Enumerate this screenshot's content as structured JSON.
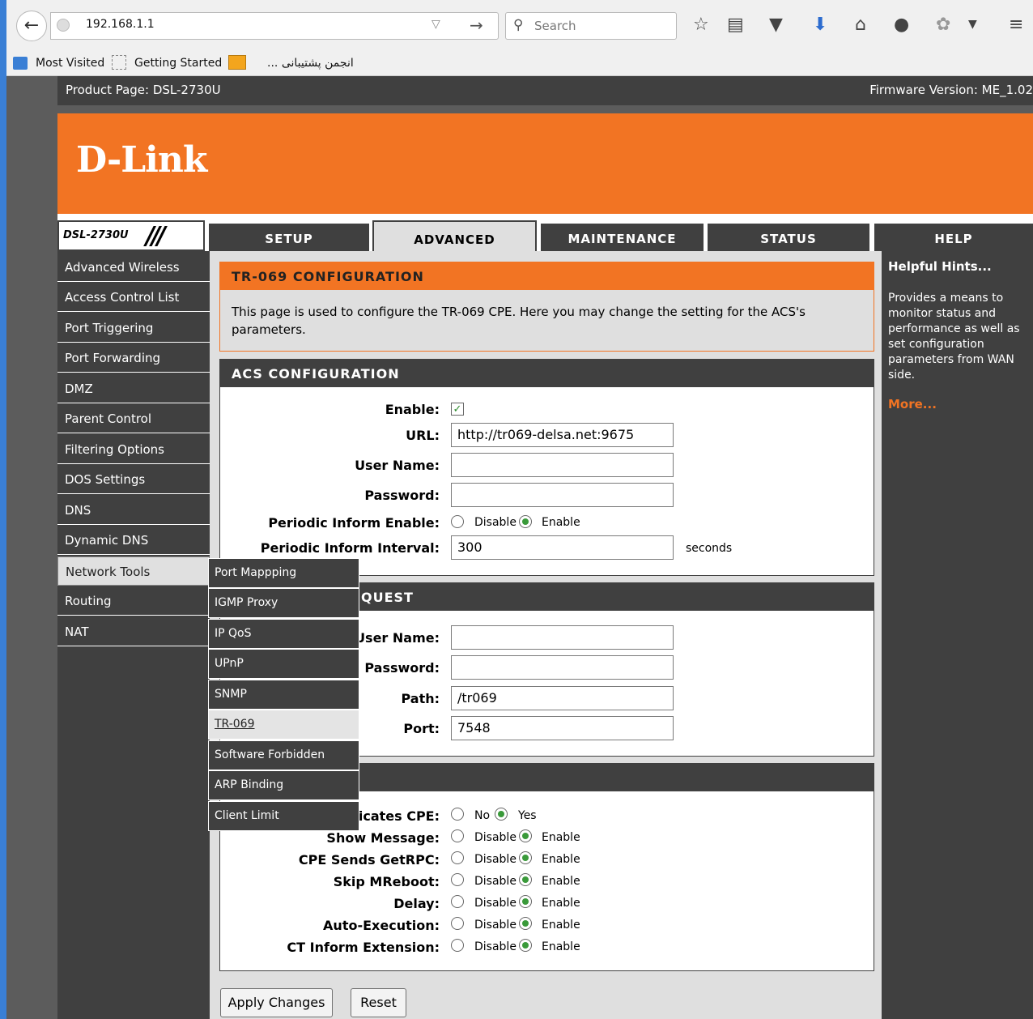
{
  "browser": {
    "url": "192.168.1.1",
    "search_placeholder": "Search",
    "bookmarks": [
      "Most Visited",
      "Getting Started",
      "... انجمن پشتیبانی"
    ]
  },
  "header": {
    "product": "Product Page: DSL-2730U",
    "firmware": "Firmware Version: ME_1.02",
    "logo": "D-Link",
    "model": "DSL-2730U"
  },
  "tabs": [
    "SETUP",
    "ADVANCED",
    "MAINTENANCE",
    "STATUS",
    "HELP"
  ],
  "sidebar": [
    "Advanced Wireless",
    "Access Control List",
    "Port Triggering",
    "Port Forwarding",
    "DMZ",
    "Parent Control",
    "Filtering Options",
    "DOS Settings",
    "DNS",
    "Dynamic DNS",
    "Network Tools",
    "Routing",
    "NAT"
  ],
  "submenu": [
    "Port Mappping",
    "IGMP Proxy",
    "IP QoS",
    "UPnP",
    "SNMP",
    "TR-069",
    "Software Forbidden",
    "ARP Binding",
    "Client Limit"
  ],
  "intro": {
    "title": "TR-069 CONFIGURATION",
    "text": "This page is used to configure the TR-069 CPE. Here you may change the setting for the ACS's parameters."
  },
  "acs": {
    "title": "ACS CONFIGURATION",
    "enable_label": "Enable:",
    "url_label": "URL:",
    "url_value": "http://tr069-delsa.net:9675",
    "user_label": "User Name:",
    "user_value": "",
    "pass_label": "Password:",
    "pass_value": "",
    "periodic_label": "Periodic Inform Enable:",
    "disable": "Disable",
    "enable": "Enable",
    "interval_label": "Periodic Inform Interval:",
    "interval_value": "300",
    "seconds": "seconds"
  },
  "conn": {
    "title_visible": "QUEST",
    "user_label": "User Name:",
    "user_value": "",
    "pass_label": "Password:",
    "pass_value": "",
    "path_label": "Path:",
    "path_value": "/tr069",
    "port_label": "Port:",
    "port_value": "7548"
  },
  "debug": {
    "cert_label": "icates CPE:",
    "no": "No",
    "yes": "Yes",
    "rows": [
      {
        "label": "Show Message:",
        "a": "Disable",
        "b": "Enable"
      },
      {
        "label": "CPE Sends GetRPC:",
        "a": "Disable",
        "b": "Enable"
      },
      {
        "label": "Skip MReboot:",
        "a": "Disable",
        "b": "Enable"
      },
      {
        "label": "Delay:",
        "a": "Disable",
        "b": "Enable"
      },
      {
        "label": "Auto-Execution:",
        "a": "Disable",
        "b": "Enable"
      },
      {
        "label": "CT Inform Extension:",
        "a": "Disable",
        "b": "Enable"
      }
    ]
  },
  "buttons": {
    "apply": "Apply Changes",
    "reset": "Reset"
  },
  "help": {
    "title": "Helpful Hints...",
    "text": "Provides a means to monitor status and performance as well as set configuration parameters from WAN side.",
    "more": "More..."
  },
  "colors": {
    "brand": "#f27423",
    "dark": "#404040"
  }
}
